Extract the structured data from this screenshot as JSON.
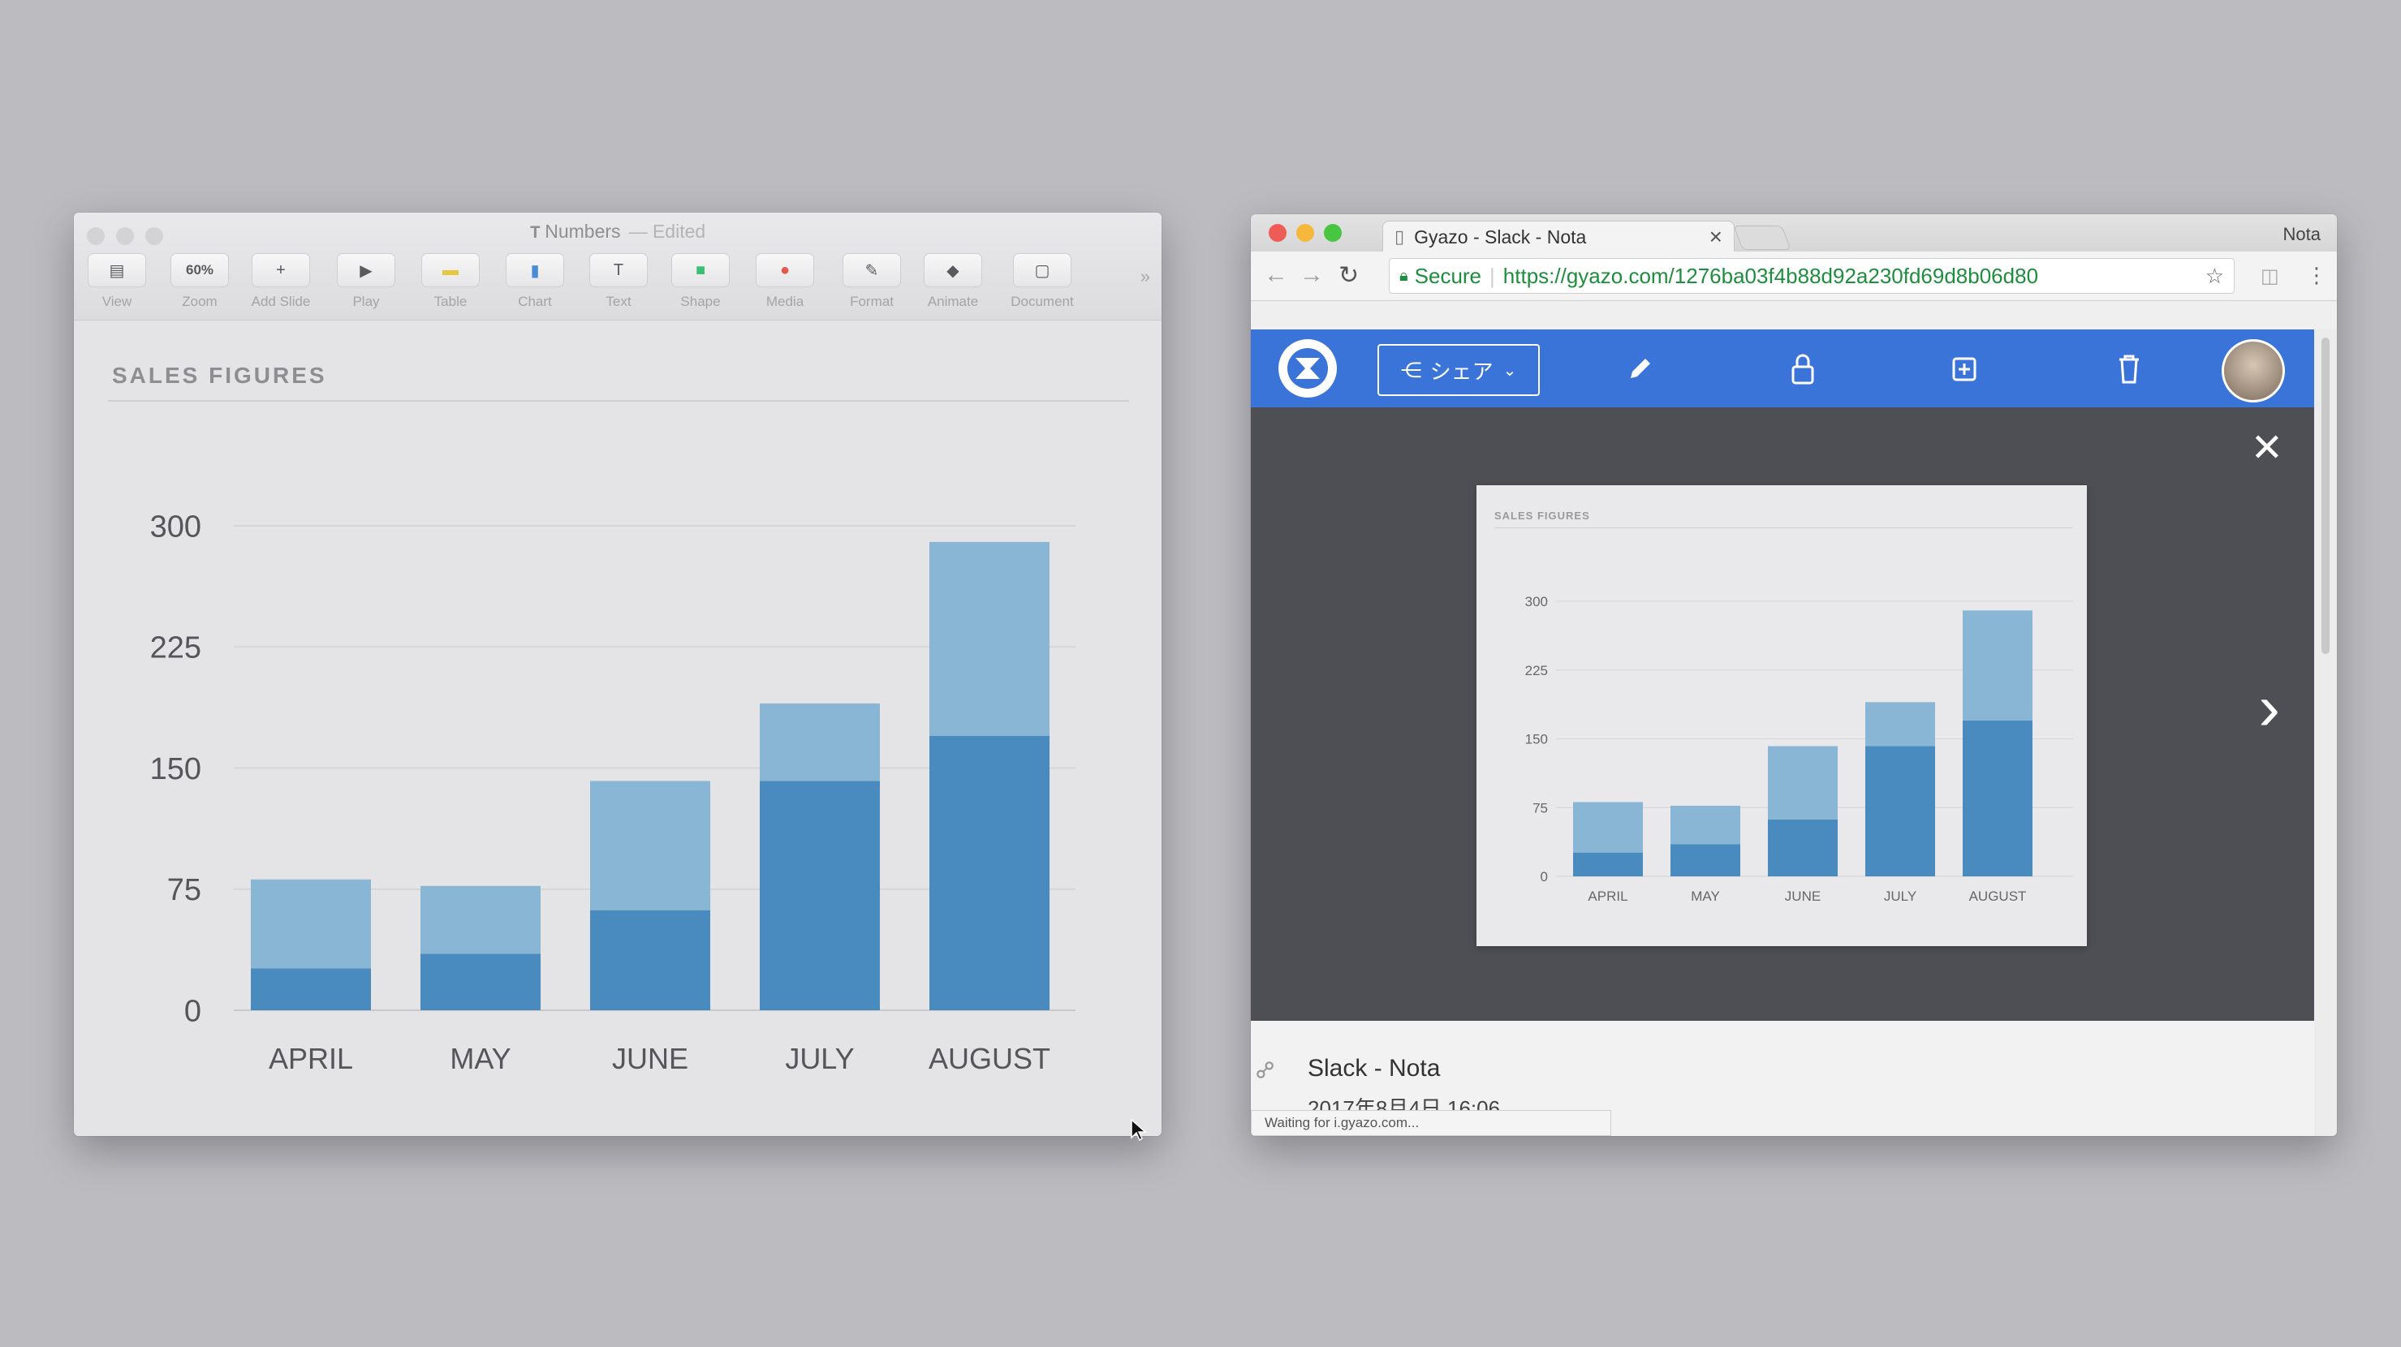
{
  "keynote": {
    "window_title": "Numbers",
    "title_status": "— Edited",
    "toolbar": [
      {
        "label": "View",
        "icon": "view-icon"
      },
      {
        "label": "Zoom",
        "icon": "zoom-icon",
        "value": "60%"
      },
      {
        "label": "Add Slide",
        "icon": "add-slide-icon"
      },
      {
        "label": "Play",
        "icon": "play-icon"
      },
      {
        "label": "Table",
        "icon": "table-icon"
      },
      {
        "label": "Chart",
        "icon": "chart-icon"
      },
      {
        "label": "Text",
        "icon": "text-icon"
      },
      {
        "label": "Shape",
        "icon": "shape-icon"
      },
      {
        "label": "Media",
        "icon": "media-icon"
      },
      {
        "label": "Format",
        "icon": "format-icon"
      },
      {
        "label": "Animate",
        "icon": "animate-icon"
      },
      {
        "label": "Document",
        "icon": "document-icon"
      }
    ],
    "overflow": "»",
    "slide_title": "SALES FIGURES"
  },
  "chart_data": [
    {
      "type": "bar",
      "stacked": true,
      "title": "SALES FIGURES",
      "categories": [
        "APRIL",
        "MAY",
        "JUNE",
        "JULY",
        "AUGUST"
      ],
      "series": [
        {
          "values": [
            26,
            35,
            62,
            142,
            170
          ],
          "color": "#4a8bbf"
        },
        {
          "values": [
            55,
            42,
            80,
            48,
            120
          ],
          "color": "#89b6d5"
        }
      ],
      "ylim": [
        0,
        300
      ],
      "yticks": [
        0,
        75,
        150,
        225,
        300
      ],
      "grid": true
    }
  ],
  "chrome": {
    "tab_title": "Gyazo - Slack - Nota",
    "tab_close": "×",
    "profile_name": "Nota",
    "secure_label": "Secure",
    "url": "https://gyazo.com/1276ba03f4b88d92a230fd69d8b06d80",
    "status_text": "Waiting for i.gyazo.com..."
  },
  "gyazo": {
    "share_label": "シェア",
    "close_glyph": "✕",
    "next_glyph": "›",
    "footer_title": "Slack - Nota",
    "footer_date": "2017年8月4日 16:06"
  },
  "colors": {
    "bar_dark": "#4a8bbf",
    "bar_light": "#89b6d5",
    "gyazo_blue": "#3b74d9",
    "viewer_bg": "#4d4f55"
  }
}
